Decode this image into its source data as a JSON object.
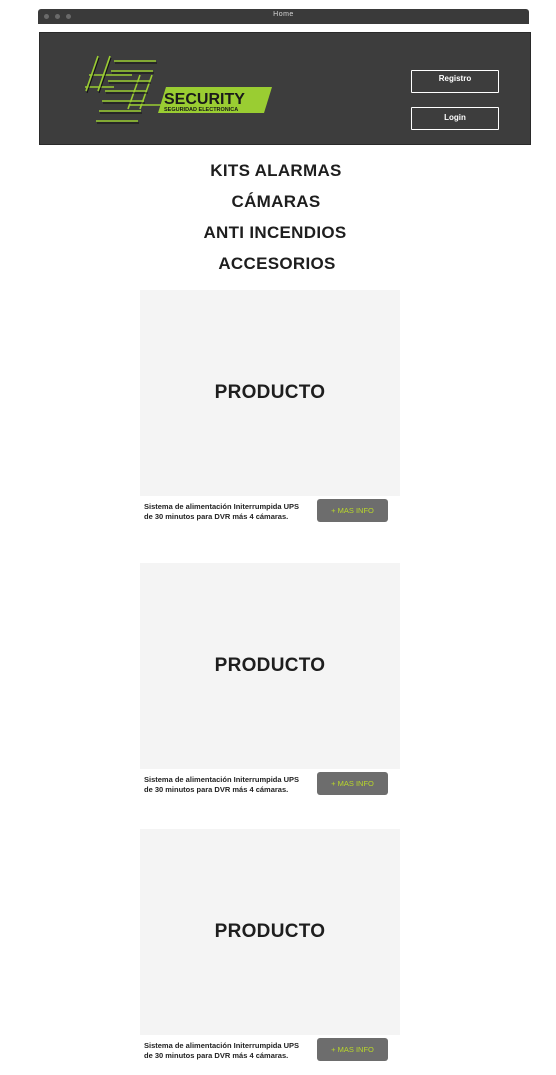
{
  "window": {
    "title": "Home"
  },
  "header": {
    "logo": {
      "brand": "SECURITY",
      "tagline": "SEGURIDAD ELECTRONICA",
      "accent": "#9acd32"
    },
    "register_label": "Registro",
    "login_label": "Login"
  },
  "nav": {
    "items": [
      {
        "label": "KITS ALARMAS"
      },
      {
        "label": "CÁMARAS"
      },
      {
        "label": "ANTI INCENDIOS"
      },
      {
        "label": "ACCESORIOS"
      }
    ]
  },
  "products": [
    {
      "image_label": "PRODUCTO",
      "description": "Sistema de alimentación Initerrumpida UPS de 30 minutos para DVR más 4 cámaras.",
      "button_label": "+ MAS INFO"
    },
    {
      "image_label": "PRODUCTO",
      "description": "Sistema de alimentación Initerrumpida UPS de 30 minutos para DVR más 4 cámaras.",
      "button_label": "+ MAS INFO"
    },
    {
      "image_label": "PRODUCTO",
      "description": "Sistema de alimentación Initerrumpida UPS de 30 minutos para DVR más 4 cámaras.",
      "button_label": "+ MAS INFO"
    }
  ],
  "colors": {
    "header_bg": "#3d3d3d",
    "accent": "#9acd32",
    "button_bg": "#6d6d6d",
    "card_bg": "#f4f4f4"
  }
}
